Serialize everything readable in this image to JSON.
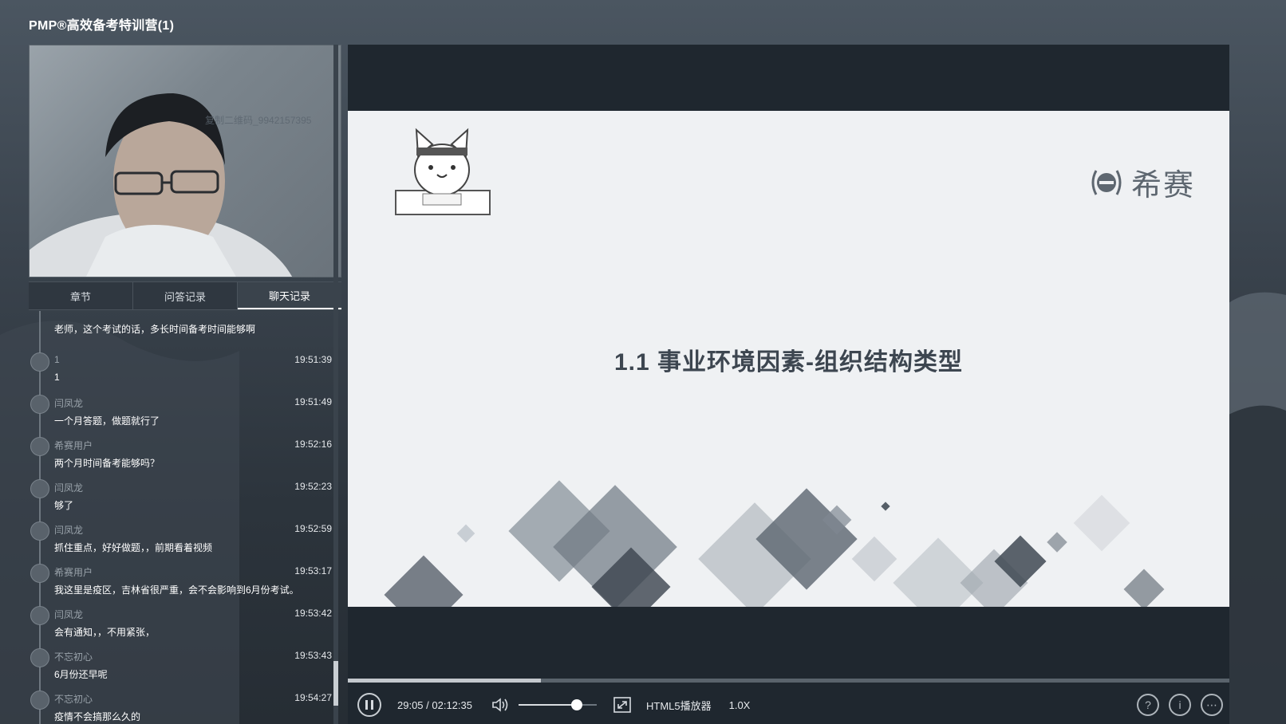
{
  "app": {
    "title": "PMP®高效备考特训营(1)"
  },
  "video": {
    "watermark": "复制二维码_9942157395"
  },
  "tabs": [
    {
      "label": "章节",
      "active": false
    },
    {
      "label": "问答记录",
      "active": false
    },
    {
      "label": "聊天记录",
      "active": true
    }
  ],
  "chat": {
    "messages": [
      {
        "name": "",
        "time": "",
        "text": "老师，这个考试的话，多长时间备考时间能够啊"
      },
      {
        "name": "1",
        "time": "19:51:39",
        "text": "1"
      },
      {
        "name": "闫凤龙",
        "time": "19:51:49",
        "text": "一个月答题，做题就行了"
      },
      {
        "name": "希赛用户",
        "time": "19:52:16",
        "text": "两个月时间备考能够吗？"
      },
      {
        "name": "闫凤龙",
        "time": "19:52:23",
        "text": "够了"
      },
      {
        "name": "闫凤龙",
        "time": "19:52:59",
        "text": "抓住重点，好好做题，，前期看着视频"
      },
      {
        "name": "希赛用户",
        "time": "19:53:17",
        "text": "我这里是疫区，吉林省很严重，会不会影响到6月份考试。"
      },
      {
        "name": "闫凤龙",
        "time": "19:53:42",
        "text": "会有通知，，不用紧张，"
      },
      {
        "name": "不忘初心",
        "time": "19:53:43",
        "text": "6月份还早呢"
      },
      {
        "name": "不忘初心",
        "time": "19:54:27",
        "text": "疫情不会搞那么久的"
      }
    ]
  },
  "slide": {
    "heading": "1.1  事业环境因素-组织结构类型",
    "brand": "希赛"
  },
  "player": {
    "time": "29:05 / 02:12:35",
    "progress": 0.219,
    "volume": 0.75,
    "label": "HTML5播放器",
    "speed": "1.0X"
  },
  "colors": {
    "slide_bg": "#eff1f3",
    "heading": "#3d4650",
    "dark_panel": "#1f272f"
  }
}
